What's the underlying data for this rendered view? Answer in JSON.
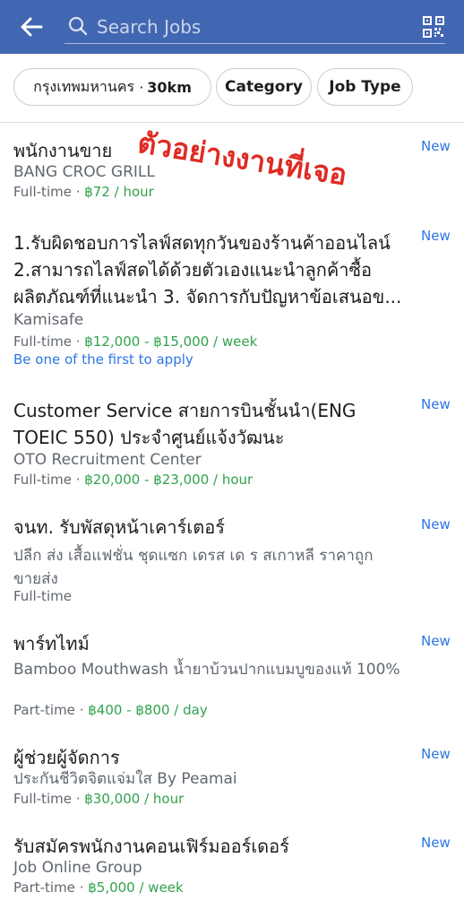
{
  "search": {
    "placeholder": "Search Jobs"
  },
  "filters": {
    "location": "กรุงเทพมหานคร",
    "radius": "30km",
    "category": "Category",
    "job_type": "Job Type"
  },
  "overlay_text": "ตัวอย่างงานที่เจอ",
  "colors": {
    "header": "#4267b2",
    "accent": "#2d76e5",
    "pay": "#31a24c",
    "overlay": "#e02b23"
  },
  "jobs": [
    {
      "title": "พนักงานขาย",
      "company": "BANG CROC GRILL",
      "type": "Full-time",
      "pay": "฿72 / hour",
      "badge": "New"
    },
    {
      "title": "1.รับผิดชอบการไลฟ์สดทุกวันของร้านค้าออนไลน์ 2.สามารถไลฟ์สดได้ด้วยตัวเองแนะนำลูกค้าซื้อผลิตภัณฑ์ที่แนะนำ 3. จัดการกับปัญหาข้อเสนอข...",
      "company": "Kamisafe",
      "type": "Full-time",
      "pay": "฿12,000 - ฿15,000 / week",
      "extra": "Be one of the first to apply",
      "badge": "New"
    },
    {
      "title": "Customer Service สายการบินชั้นนำ(ENG TOEIC 550) ประจำศูนย์แจ้งวัฒนะ",
      "company": "OTO Recruitment Center",
      "type": "Full-time",
      "pay": "฿20,000 - ฿23,000 / hour",
      "badge": "New"
    },
    {
      "title": "จนท. รับพัสดุหน้าเคาร์เตอร์",
      "company": "ปลีก ส่ง เสื้อแฟชั่น ชุดแซก เดรส เด ร สเกาหลี ราคาถูก ขายส่ง",
      "type": "Full-time",
      "pay": "",
      "badge": "New"
    },
    {
      "title": "พาร์ทไทม์",
      "company": "Bamboo Mouthwash น้ำยาบ้วนปากแบมบูของแท้ 100%",
      "type": "Part-time",
      "pay": "฿400 - ฿800 / day",
      "badge": "New"
    },
    {
      "title": "ผู้ช่วยผู้จัดการ",
      "company": "ประกันชีวิตจิตแจ่มใส By Peamai",
      "type": "Full-time",
      "pay": "฿30,000 / hour",
      "badge": "New"
    },
    {
      "title": "รับสมัครพนักงานคอนเฟิร์มออร์เดอร์",
      "company": "Job Online Group",
      "type": "Part-time",
      "pay": "฿5,000 / week",
      "badge": "New"
    }
  ]
}
